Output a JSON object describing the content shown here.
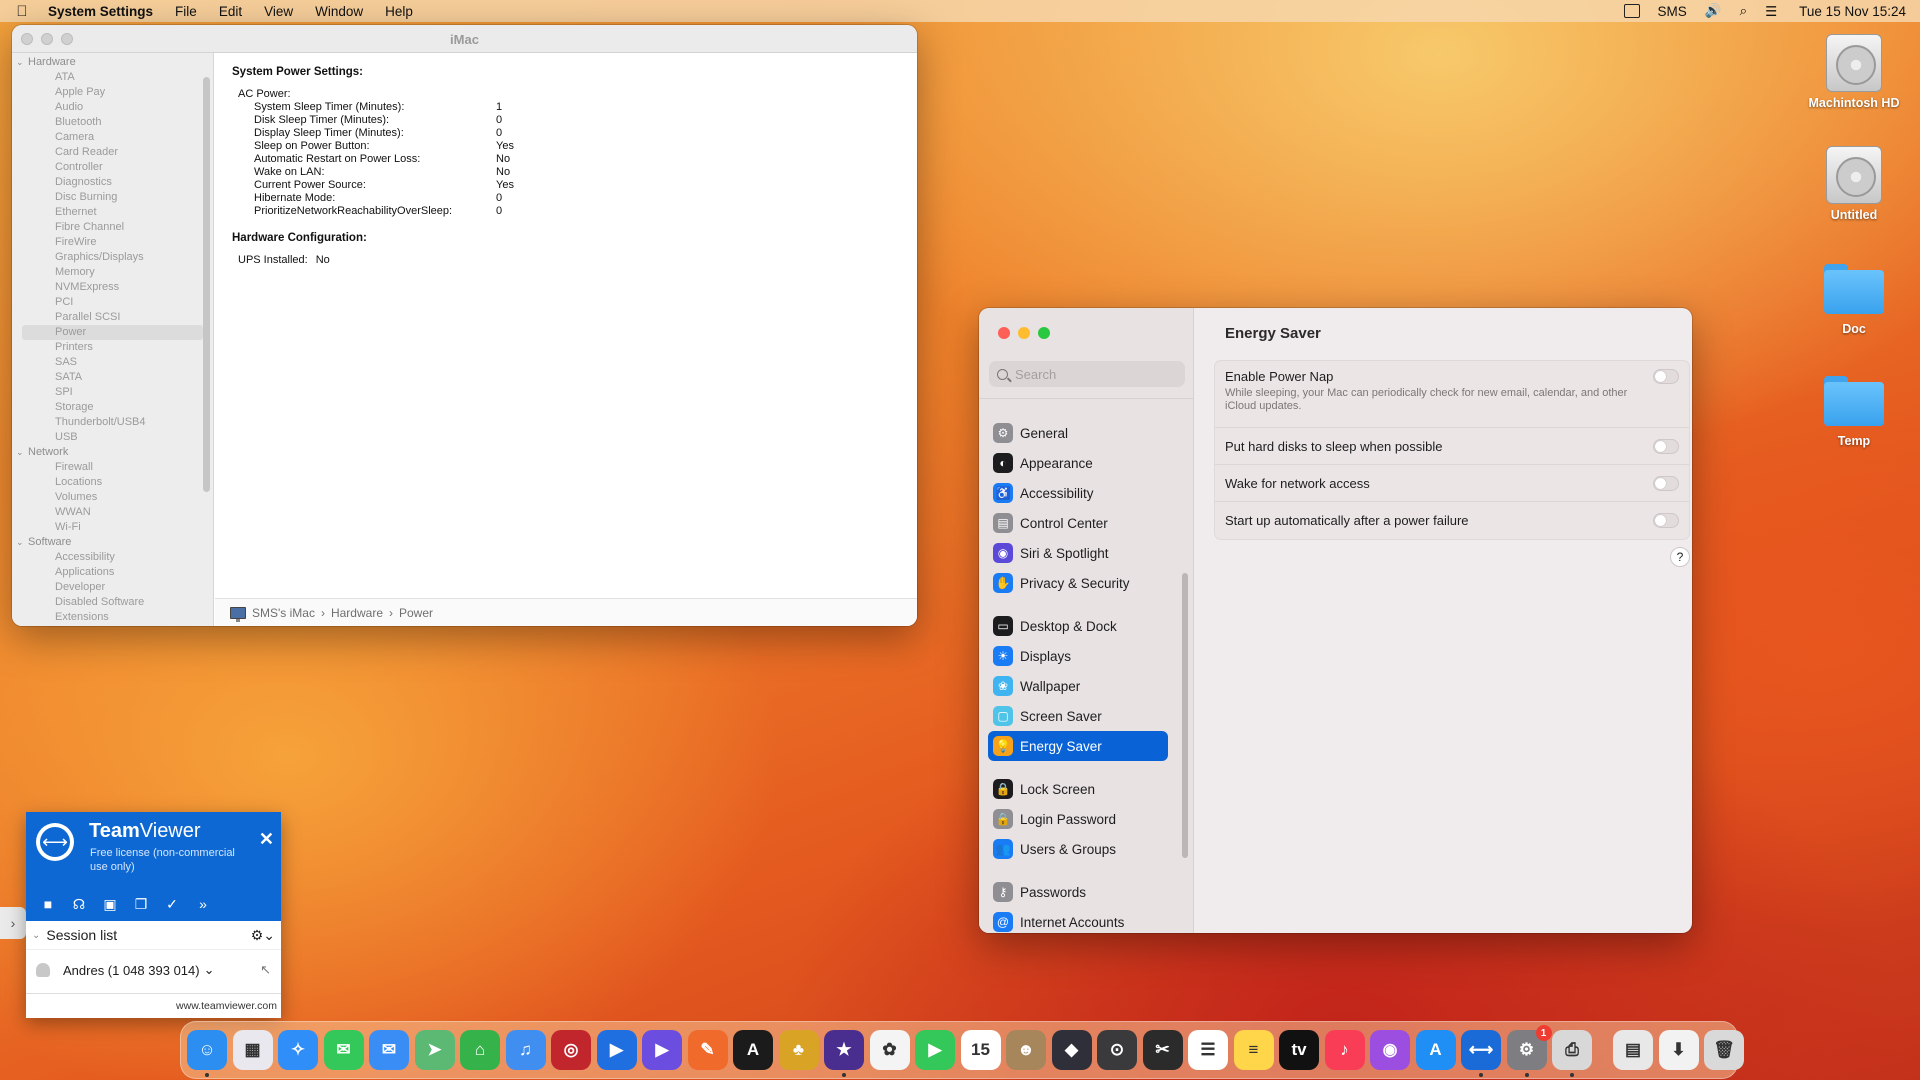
{
  "menubar": {
    "app_name": "System Settings",
    "menus": [
      "File",
      "Edit",
      "View",
      "Window",
      "Help"
    ],
    "user": "SMS",
    "datetime": "Tue 15 Nov  15:24"
  },
  "sysinfo": {
    "window_title": "iMac",
    "tree": [
      {
        "type": "group",
        "label": "Hardware"
      },
      {
        "type": "child",
        "label": "ATA"
      },
      {
        "type": "child",
        "label": "Apple Pay"
      },
      {
        "type": "child",
        "label": "Audio"
      },
      {
        "type": "child",
        "label": "Bluetooth"
      },
      {
        "type": "child",
        "label": "Camera"
      },
      {
        "type": "child",
        "label": "Card Reader"
      },
      {
        "type": "child",
        "label": "Controller"
      },
      {
        "type": "child",
        "label": "Diagnostics"
      },
      {
        "type": "child",
        "label": "Disc Burning"
      },
      {
        "type": "child",
        "label": "Ethernet"
      },
      {
        "type": "child",
        "label": "Fibre Channel"
      },
      {
        "type": "child",
        "label": "FireWire"
      },
      {
        "type": "child",
        "label": "Graphics/Displays"
      },
      {
        "type": "child",
        "label": "Memory"
      },
      {
        "type": "child",
        "label": "NVMExpress"
      },
      {
        "type": "child",
        "label": "PCI"
      },
      {
        "type": "child",
        "label": "Parallel SCSI"
      },
      {
        "type": "child",
        "label": "Power",
        "selected": true
      },
      {
        "type": "child",
        "label": "Printers"
      },
      {
        "type": "child",
        "label": "SAS"
      },
      {
        "type": "child",
        "label": "SATA"
      },
      {
        "type": "child",
        "label": "SPI"
      },
      {
        "type": "child",
        "label": "Storage"
      },
      {
        "type": "child",
        "label": "Thunderbolt/USB4"
      },
      {
        "type": "child",
        "label": "USB"
      },
      {
        "type": "group",
        "label": "Network"
      },
      {
        "type": "child",
        "label": "Firewall"
      },
      {
        "type": "child",
        "label": "Locations"
      },
      {
        "type": "child",
        "label": "Volumes"
      },
      {
        "type": "child",
        "label": "WWAN"
      },
      {
        "type": "child",
        "label": "Wi-Fi"
      },
      {
        "type": "group",
        "label": "Software"
      },
      {
        "type": "child",
        "label": "Accessibility"
      },
      {
        "type": "child",
        "label": "Applications"
      },
      {
        "type": "child",
        "label": "Developer"
      },
      {
        "type": "child",
        "label": "Disabled Software"
      },
      {
        "type": "child",
        "label": "Extensions"
      }
    ],
    "power_heading": "System Power Settings:",
    "ac_power_label": "AC Power:",
    "settings": [
      {
        "k": "System Sleep Timer (Minutes):",
        "v": "1"
      },
      {
        "k": "Disk Sleep Timer (Minutes):",
        "v": "0"
      },
      {
        "k": "Display Sleep Timer (Minutes):",
        "v": "0"
      },
      {
        "k": "Sleep on Power Button:",
        "v": "Yes"
      },
      {
        "k": "Automatic Restart on Power Loss:",
        "v": "No"
      },
      {
        "k": "Wake on LAN:",
        "v": "No"
      },
      {
        "k": "Current Power Source:",
        "v": "Yes"
      },
      {
        "k": "Hibernate Mode:",
        "v": "0"
      },
      {
        "k": "PrioritizeNetworkReachabilityOverSleep:",
        "v": "0"
      }
    ],
    "hw_heading": "Hardware Configuration:",
    "ups_label": "UPS Installed:",
    "ups_value": "No",
    "path": [
      "SMS's iMac",
      "Hardware",
      "Power"
    ]
  },
  "settings": {
    "search_placeholder": "Search",
    "nav": [
      {
        "label": "General",
        "icon": "gear-icon",
        "color": "#8e8e93",
        "glyph": "⚙"
      },
      {
        "label": "Appearance",
        "icon": "appearance-icon",
        "color": "#1c1c1e",
        "glyph": "◐"
      },
      {
        "label": "Accessibility",
        "icon": "accessibility-icon",
        "color": "#1a7cf5",
        "glyph": "♿"
      },
      {
        "label": "Control Center",
        "icon": "control-center-icon",
        "color": "#8e8e93",
        "glyph": "▤"
      },
      {
        "label": "Siri & Spotlight",
        "icon": "siri-icon",
        "color": "#5b4ad8",
        "glyph": "◉"
      },
      {
        "label": "Privacy & Security",
        "icon": "hand-icon",
        "color": "#1a7cf5",
        "glyph": "✋",
        "gap_after": true
      },
      {
        "label": "Desktop & Dock",
        "icon": "dock-icon",
        "color": "#1c1c1e",
        "glyph": "▭"
      },
      {
        "label": "Displays",
        "icon": "displays-icon",
        "color": "#1a7cf5",
        "glyph": "☀"
      },
      {
        "label": "Wallpaper",
        "icon": "wallpaper-icon",
        "color": "#3fb4f0",
        "glyph": "❀"
      },
      {
        "label": "Screen Saver",
        "icon": "screen-saver-icon",
        "color": "#4fc3e8",
        "glyph": "▢"
      },
      {
        "label": "Energy Saver",
        "icon": "bulb-icon",
        "color": "#f7a21b",
        "glyph": "💡",
        "active": true,
        "gap_after": true
      },
      {
        "label": "Lock Screen",
        "icon": "lock-icon",
        "color": "#1c1c1e",
        "glyph": "🔒"
      },
      {
        "label": "Login Password",
        "icon": "login-lock-icon",
        "color": "#8e8e93",
        "glyph": "🔒"
      },
      {
        "label": "Users & Groups",
        "icon": "users-icon",
        "color": "#1a7cf5",
        "glyph": "👥",
        "gap_after": true
      },
      {
        "label": "Passwords",
        "icon": "key-icon",
        "color": "#8e8e93",
        "glyph": "⚷"
      },
      {
        "label": "Internet Accounts",
        "icon": "at-icon",
        "color": "#1a7cf5",
        "glyph": "@"
      }
    ],
    "pane_title": "Energy Saver",
    "options": [
      {
        "label": "Enable Power Nap",
        "desc": "While sleeping, your Mac can periodically check for new email, calendar, and other iCloud updates.",
        "on": false
      },
      {
        "label": "Put hard disks to sleep when possible",
        "desc": "",
        "on": false
      },
      {
        "label": "Wake for network access",
        "desc": "",
        "on": false
      },
      {
        "label": "Start up automatically after a power failure",
        "desc": "",
        "on": false
      }
    ],
    "help_label": "?"
  },
  "desktop": {
    "icons": [
      {
        "label": "Machintosh HD",
        "kind": "disk"
      },
      {
        "label": "Untitled",
        "kind": "disk"
      },
      {
        "label": "Doc",
        "kind": "folder"
      },
      {
        "label": "Temp",
        "kind": "folder"
      }
    ]
  },
  "teamviewer": {
    "brand_bold": "Team",
    "brand_rest": "Viewer",
    "license": "Free license (non-commercial use only)",
    "close": "✕",
    "session_list": "Session list",
    "contact": "Andres (1 048 393 014)",
    "url": "www.teamviewer.com"
  },
  "dock": {
    "apps": [
      {
        "name": "finder-icon",
        "color": "#2b8ef0",
        "glyph": "☺",
        "running": true
      },
      {
        "name": "launchpad-icon",
        "color": "#e8e8ee",
        "glyph": "▦"
      },
      {
        "name": "safari-icon",
        "color": "#2f8ef7",
        "glyph": "✧"
      },
      {
        "name": "messages-icon",
        "color": "#34c759",
        "glyph": "✉"
      },
      {
        "name": "mail-icon",
        "color": "#3a8df5",
        "glyph": "✉"
      },
      {
        "name": "maps-icon",
        "color": "#5bb974",
        "glyph": "➤"
      },
      {
        "name": "airdroid-icon",
        "color": "#35b34a",
        "glyph": "⌂"
      },
      {
        "name": "cloud-music-icon",
        "color": "#3f8ef0",
        "glyph": "♫"
      },
      {
        "name": "aperture-icon",
        "color": "#c0262c",
        "glyph": "◎"
      },
      {
        "name": "transfer-icon",
        "color": "#1f6fe0",
        "glyph": "▶"
      },
      {
        "name": "video-icon",
        "color": "#6b4de0",
        "glyph": "▶"
      },
      {
        "name": "vector-icon",
        "color": "#f06a2b",
        "glyph": "✎"
      },
      {
        "name": "affinity-icon",
        "color": "#1b1b1b",
        "glyph": "A"
      },
      {
        "name": "pineapple-icon",
        "color": "#d9a425",
        "glyph": "♣"
      },
      {
        "name": "imovie-icon",
        "color": "#4a2e8f",
        "glyph": "★",
        "running": true
      },
      {
        "name": "photos-icon",
        "color": "#f4f4f4",
        "glyph": "✿"
      },
      {
        "name": "facetime-icon",
        "color": "#34c759",
        "glyph": "▶"
      },
      {
        "name": "calendar-icon",
        "color": "#ffffff",
        "glyph": "15"
      },
      {
        "name": "contacts-icon",
        "color": "#a8865b",
        "glyph": "☻"
      },
      {
        "name": "pixelmator-icon",
        "color": "#2f2f3a",
        "glyph": "◆"
      },
      {
        "name": "screenshot-icon",
        "color": "#3a3a3c",
        "glyph": "⊙"
      },
      {
        "name": "final-cut-icon",
        "color": "#2b2b2b",
        "glyph": "✂"
      },
      {
        "name": "reminders-icon",
        "color": "#ffffff",
        "glyph": "☰"
      },
      {
        "name": "notes-icon",
        "color": "#ffd54a",
        "glyph": "≡"
      },
      {
        "name": "apple-tv-icon",
        "color": "#111111",
        "glyph": "tv"
      },
      {
        "name": "music-icon",
        "color": "#fa3d57",
        "glyph": "♪"
      },
      {
        "name": "podcasts-icon",
        "color": "#9b4ee0",
        "glyph": "◉"
      },
      {
        "name": "app-store-icon",
        "color": "#1f8ef5",
        "glyph": "A"
      },
      {
        "name": "teamviewer-dock-icon",
        "color": "#1a6bd8",
        "glyph": "⟷",
        "running": true
      },
      {
        "name": "system-settings-icon",
        "color": "#7d7d82",
        "glyph": "⚙",
        "badge": "1",
        "running": true
      },
      {
        "name": "printer-icon",
        "color": "#d8d8d8",
        "glyph": "⎙",
        "running": true
      },
      {
        "name": "documents-stack-icon",
        "color": "#e8e8e8",
        "glyph": "▤",
        "separator_before": true
      },
      {
        "name": "downloads-stack-icon",
        "color": "#f2f2f2",
        "glyph": "⬇"
      },
      {
        "name": "trash-icon",
        "color": "#d9d9d9",
        "glyph": "🗑"
      }
    ]
  }
}
